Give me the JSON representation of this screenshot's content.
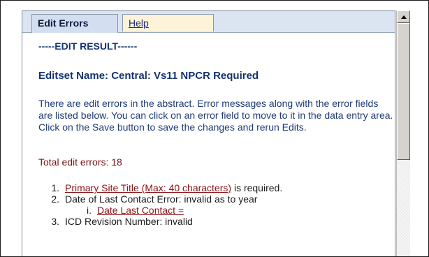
{
  "tabs": {
    "edit_errors": "Edit Errors",
    "help": "Help"
  },
  "content": {
    "result_header": "-----EDIT RESULT------",
    "editset": "Editset Name: Central: Vs11 NPCR Required",
    "description": "There are edit errors in the abstract. Error messages along with the error fields are listed below. You can click on an error field to move to it in the data entry area. Click on the Save button to save the changes and rerun Edits.",
    "total_errors": "Total edit errors: 18"
  },
  "errors": [
    {
      "num": "1.",
      "link": "Primary Site Title (Max: 40 characters)",
      "text": " is required."
    },
    {
      "num": "2.",
      "link": "",
      "text": "Date of Last Contact Error: invalid as to year"
    },
    {
      "sub_num": "i.",
      "link": "Date Last Contact ="
    },
    {
      "num": "3.",
      "text": "ICD Revision Number: invalid"
    }
  ],
  "colors": {
    "tab_active_bg": "#d3def0",
    "tab_help_bg": "#fdf3d9",
    "link_error": "#8b1216",
    "heading": "#13336f"
  }
}
